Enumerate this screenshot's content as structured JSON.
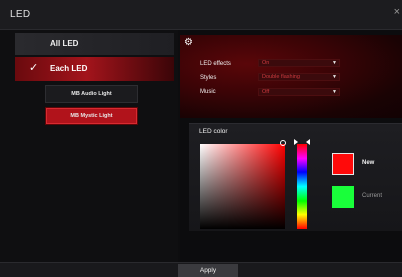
{
  "window": {
    "title": "LED",
    "close_glyph": "×"
  },
  "sidebar": {
    "all_led_label": "All LED",
    "each_led_label": "Each LED",
    "check_glyph": "✓",
    "devices": [
      {
        "label": "MB Audio Light",
        "selected": false
      },
      {
        "label": "MB Mystic Light",
        "selected": true
      }
    ]
  },
  "settings": {
    "icon": "gear-icon",
    "led_effects": {
      "label": "LED effects",
      "value": "On"
    },
    "styles": {
      "label": "Styles",
      "value": "Double flashing"
    },
    "music": {
      "label": "Music",
      "value": "Off"
    }
  },
  "led_color": {
    "title": "LED color",
    "new_label": "New",
    "current_label": "Current",
    "new_color": "#ff0a0a",
    "current_color": "#19ff3a",
    "hue_color": "#ff0000"
  },
  "footer": {
    "apply_label": "Apply"
  },
  "colors": {
    "accent_red": "#b1131b",
    "background": "#0d0d0f"
  }
}
